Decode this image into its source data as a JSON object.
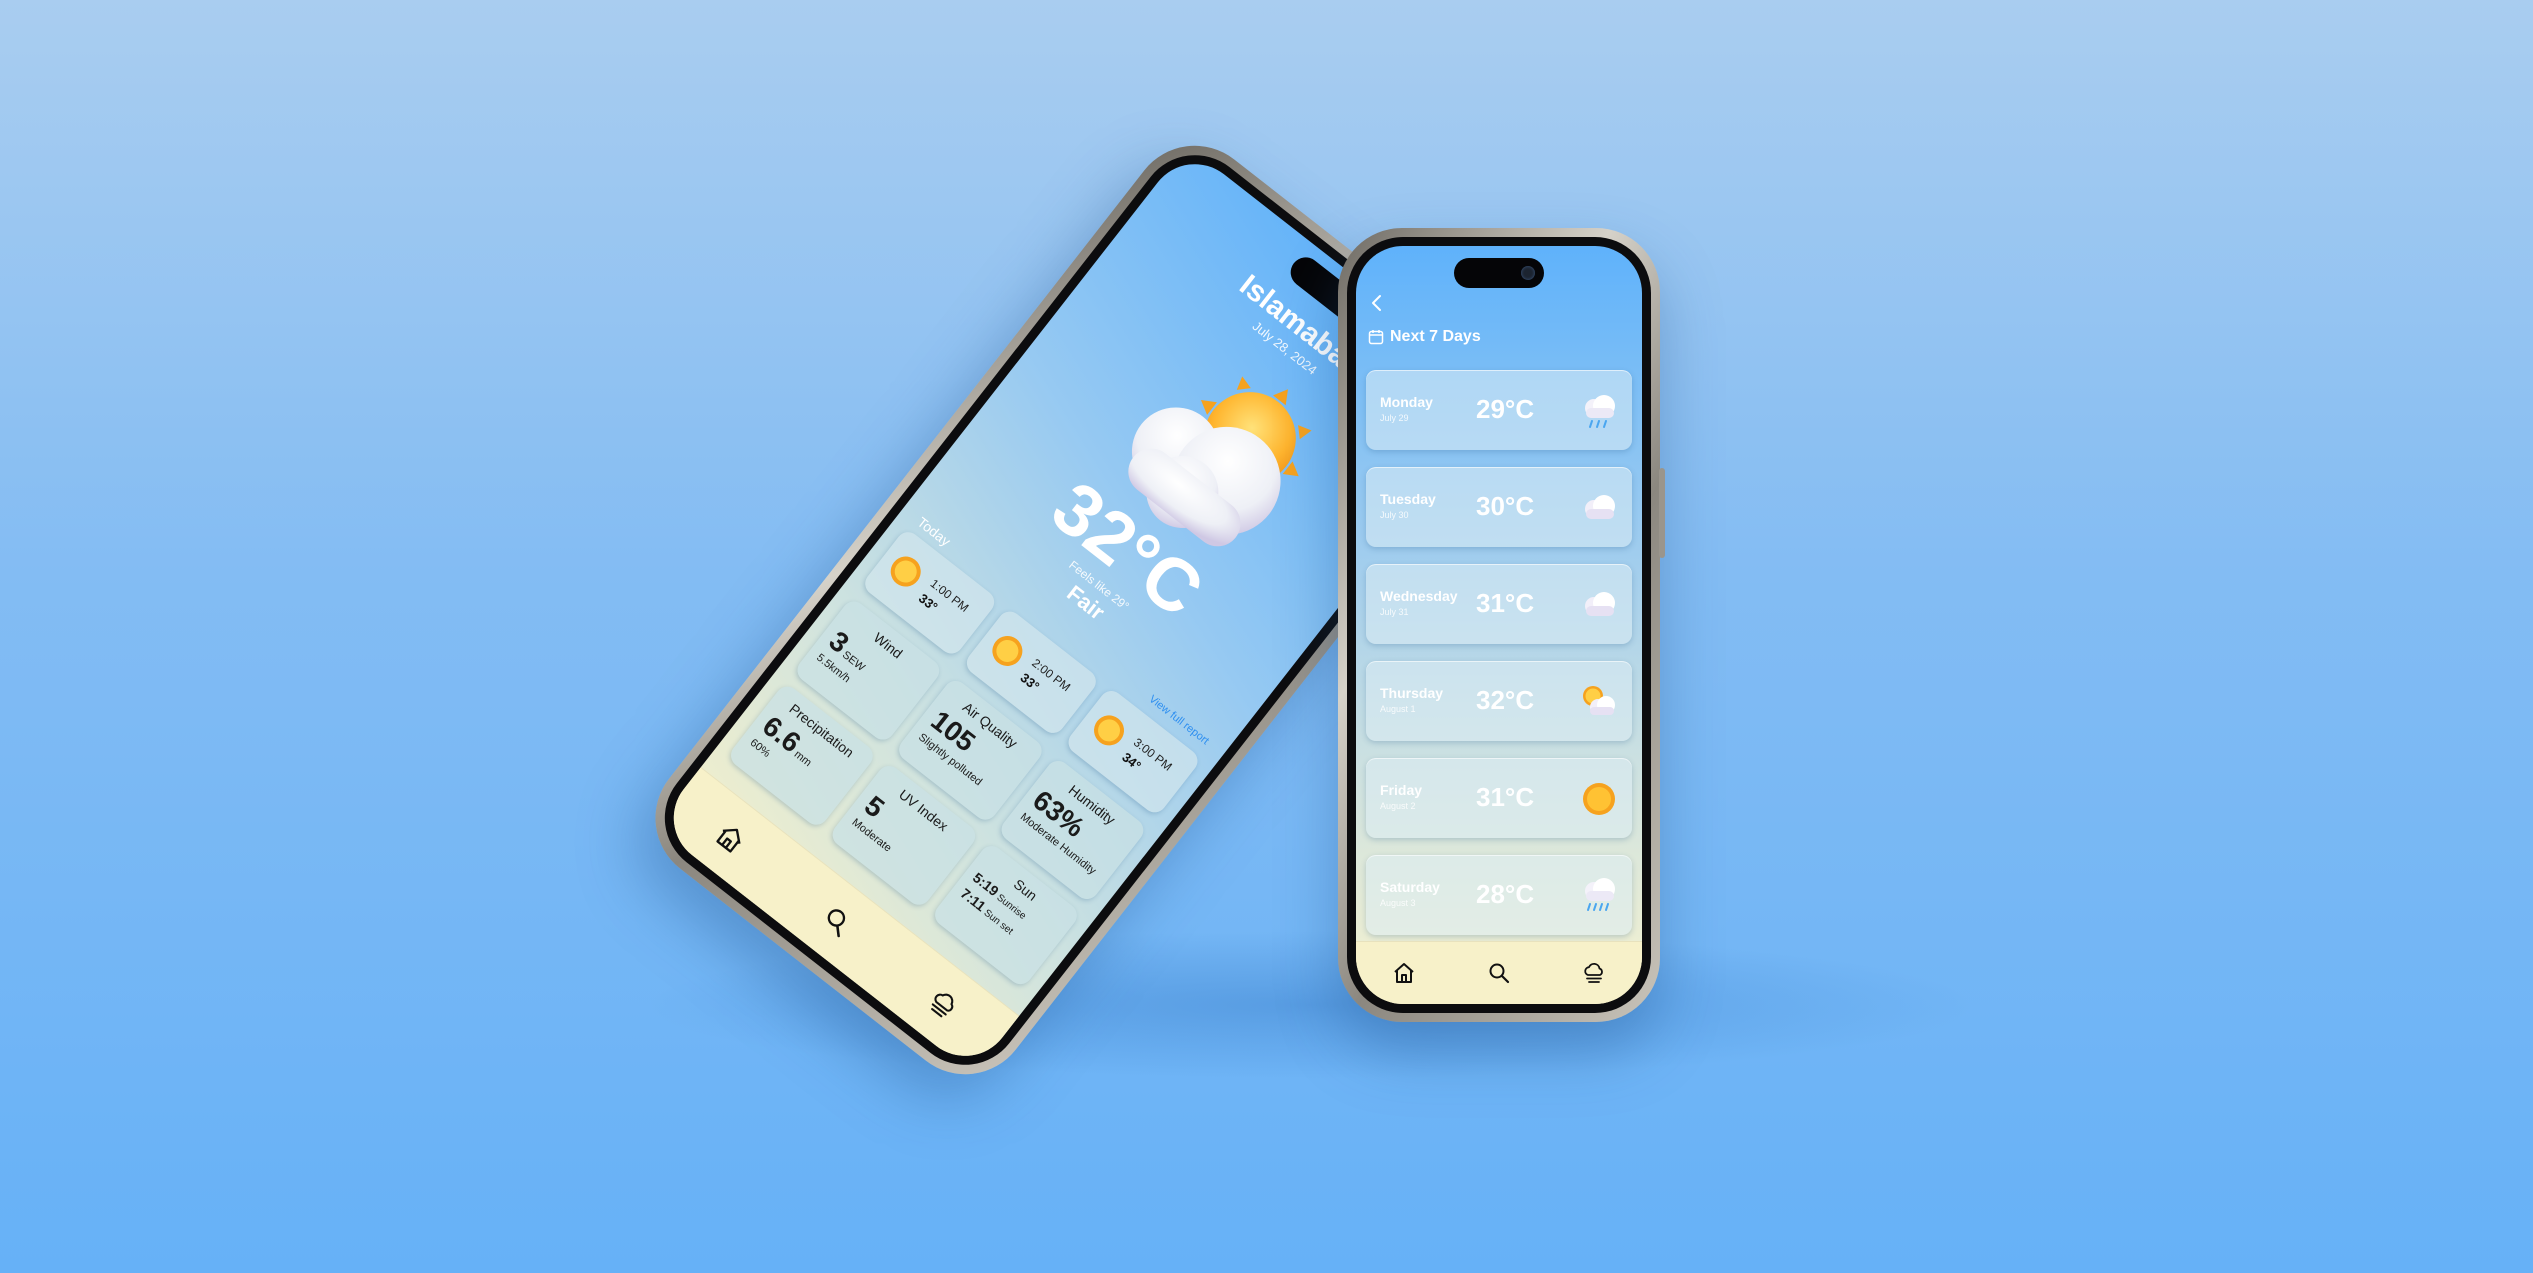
{
  "next_days": {
    "header": "Next 7 Days",
    "back_icon": "chevron-left-icon",
    "days": [
      {
        "name": "Monday",
        "date": "July 29",
        "temp": "29°C",
        "icon": "cloud-rain-icon"
      },
      {
        "name": "Tuesday",
        "date": "July 30",
        "temp": "30°C",
        "icon": "cloud-icon"
      },
      {
        "name": "Wednesday",
        "date": "July 31",
        "temp": "31°C",
        "icon": "cloud-icon"
      },
      {
        "name": "Thursday",
        "date": "August 1",
        "temp": "32°C",
        "icon": "sun-cloud-icon"
      },
      {
        "name": "Friday",
        "date": "August 2",
        "temp": "31°C",
        "icon": "sun-icon"
      },
      {
        "name": "Saturday",
        "date": "August 3",
        "temp": "28°C",
        "icon": "cloud-rain-icon"
      }
    ]
  },
  "current": {
    "city": "Islamabad",
    "date": "July 28, 2024",
    "temp": "32°C",
    "feels_like": "Feels like 29°",
    "condition": "Fair",
    "today_label": "Today",
    "view_link": "View full report",
    "hourly": [
      {
        "time": "1:00 PM",
        "temp": "33°"
      },
      {
        "time": "2:00 PM",
        "temp": "33°"
      },
      {
        "time": "3:00 PM",
        "temp": "34°"
      }
    ],
    "metrics": {
      "wind": {
        "title": "Wind",
        "value": "3",
        "unit": "SEW",
        "sub": "5.5km/h"
      },
      "air": {
        "title": "Air Quality",
        "value": "105",
        "sub": "Slightly polluted"
      },
      "humidity": {
        "title": "Humidity",
        "value": "63%",
        "sub": "Moderate Humidity"
      },
      "precip": {
        "title": "Precipitation",
        "value": "6.6",
        "unit": "mm",
        "sub": "60%"
      },
      "uv": {
        "title": "UV Index",
        "value": "5",
        "sub": "Moderate"
      },
      "sun": {
        "title": "Sun",
        "rise": "5:19",
        "rise_label": "Sunrise",
        "set": "7:11",
        "set_label": "Sun set"
      }
    }
  },
  "nav": {
    "home_icon": "home-icon",
    "search_icon": "search-icon",
    "weather_icon": "cloud-weather-icon"
  },
  "colors": {
    "accent": "#2e8ff0",
    "nav_bg": "#f7f1c9",
    "sky_top": "#5fb2fb"
  }
}
